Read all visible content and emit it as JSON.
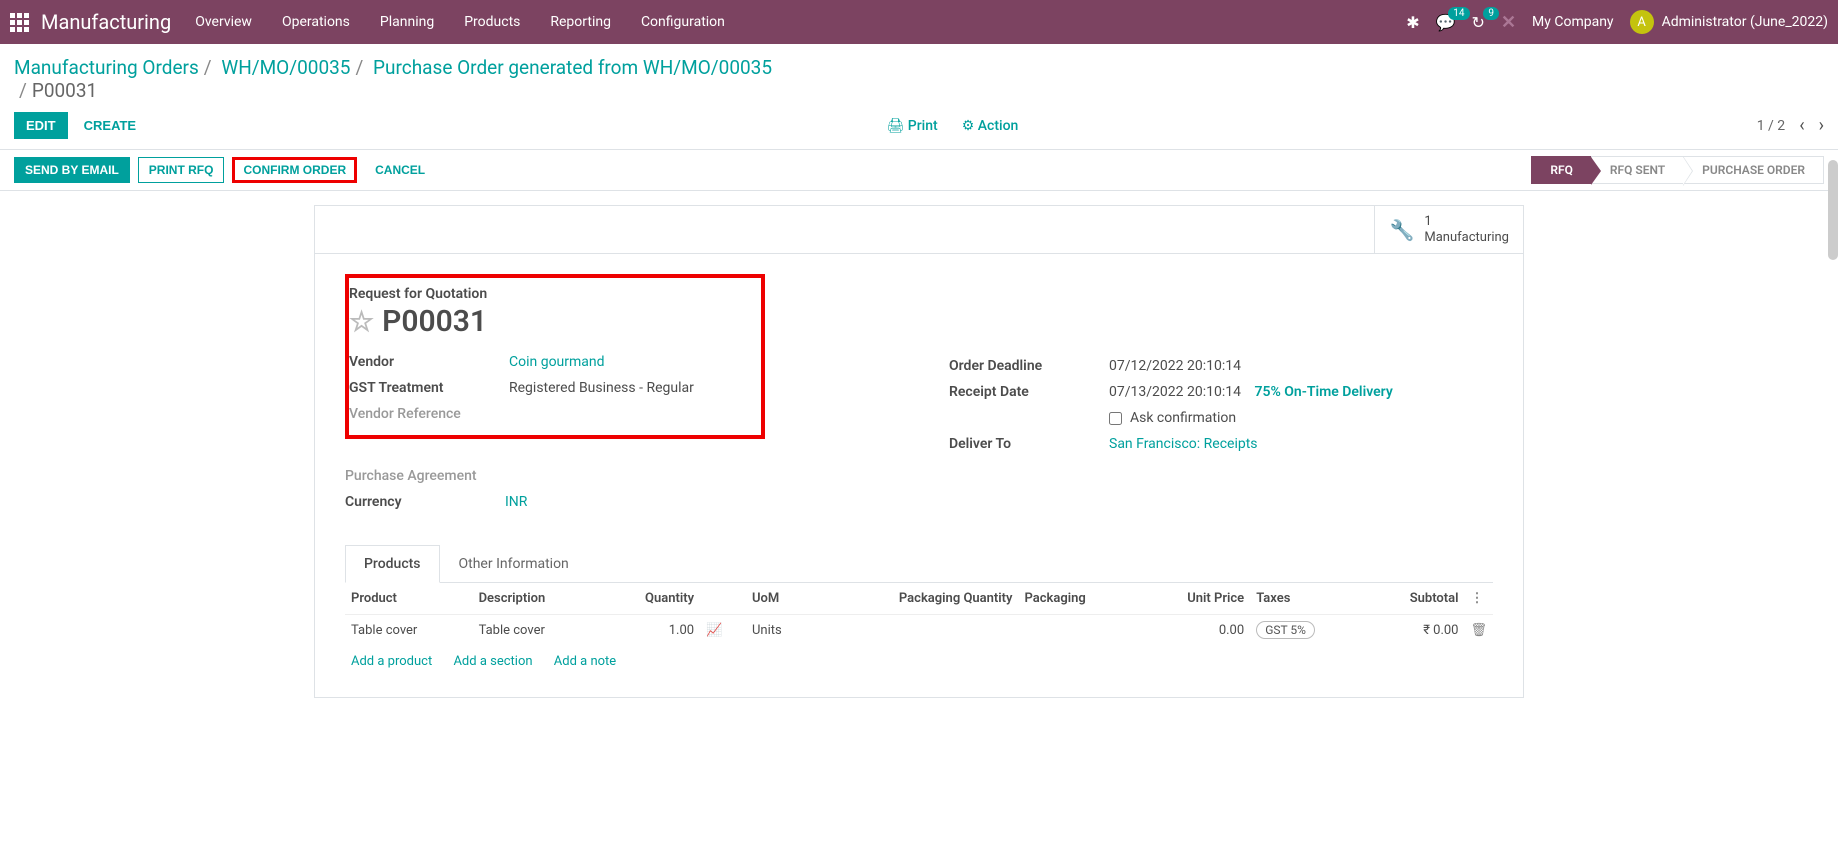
{
  "navbar": {
    "brand": "Manufacturing",
    "menu": [
      "Overview",
      "Operations",
      "Planning",
      "Products",
      "Reporting",
      "Configuration"
    ],
    "conv_badge": "14",
    "activity_badge": "9",
    "company": "My Company",
    "avatar_letter": "A",
    "user": "Administrator (June_2022)"
  },
  "breadcrumb": {
    "items": [
      "Manufacturing Orders",
      "WH/MO/00035",
      "Purchase Order generated from WH/MO/00035"
    ],
    "current": "P00031"
  },
  "controls": {
    "edit": "EDIT",
    "create": "CREATE",
    "print": "Print",
    "action": "Action",
    "pager": "1 / 2"
  },
  "statusbar": {
    "send_email": "SEND BY EMAIL",
    "print_rfq": "PRINT RFQ",
    "confirm": "CONFIRM ORDER",
    "cancel": "CANCEL",
    "stages": [
      {
        "label": "RFQ",
        "active": true
      },
      {
        "label": "RFQ SENT",
        "active": false
      },
      {
        "label": "PURCHASE ORDER",
        "active": false
      }
    ]
  },
  "stat_button": {
    "count": "1",
    "label": "Manufacturing"
  },
  "form": {
    "label": "Request for Quotation",
    "name": "P00031",
    "vendor_label": "Vendor",
    "vendor": "Coin gourmand",
    "gst_label": "GST Treatment",
    "gst": "Registered Business - Regular",
    "vendor_ref_label": "Vendor Reference",
    "purchase_agreement_label": "Purchase Agreement",
    "currency_label": "Currency",
    "currency": "INR",
    "deadline_label": "Order Deadline",
    "deadline": "07/12/2022 20:10:14",
    "receipt_label": "Receipt Date",
    "receipt": "07/13/2022 20:10:14",
    "delivery_pct": "75% On-Time Delivery",
    "ask_label": "Ask confirmation",
    "deliver_label": "Deliver To",
    "deliver": "San Francisco: Receipts"
  },
  "tabs": {
    "products": "Products",
    "other": "Other Information"
  },
  "table": {
    "headers": {
      "product": "Product",
      "description": "Description",
      "quantity": "Quantity",
      "uom": "UoM",
      "pkg_qty": "Packaging Quantity",
      "packaging": "Packaging",
      "unit_price": "Unit Price",
      "taxes": "Taxes",
      "subtotal": "Subtotal"
    },
    "row": {
      "product": "Table cover",
      "description": "Table cover",
      "quantity": "1.00",
      "uom": "Units",
      "unit_price": "0.00",
      "tax": "GST 5%",
      "subtotal": "₹ 0.00"
    },
    "add_product": "Add a product",
    "add_section": "Add a section",
    "add_note": "Add a note"
  }
}
